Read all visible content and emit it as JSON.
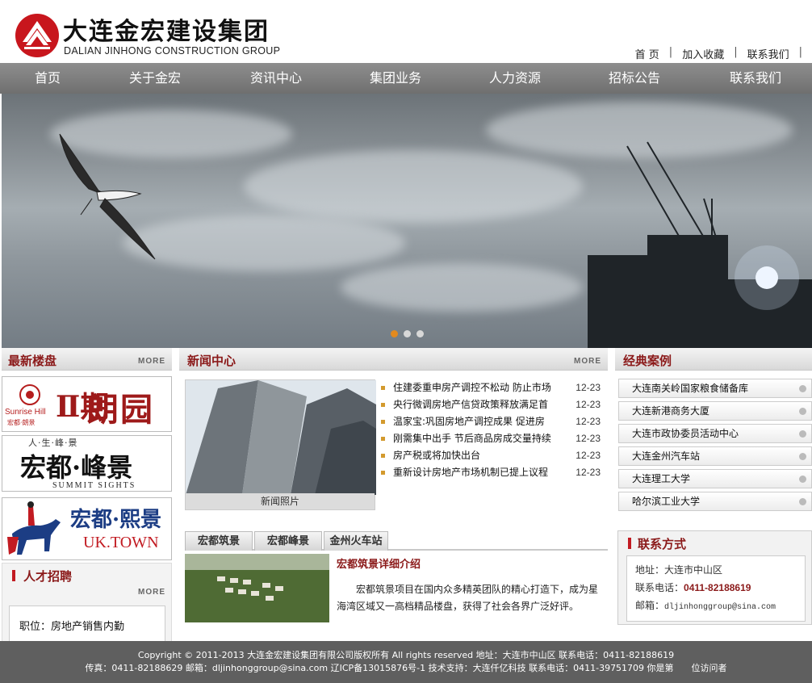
{
  "header": {
    "logo_cn": "大连金宏建设集团",
    "logo_en": "DALIAN JINHONG CONSTRUCTION GROUP",
    "links": [
      "首 页",
      "加入收藏",
      "联系我们"
    ]
  },
  "nav": {
    "items": [
      "首页",
      "关于金宏",
      "资讯中心",
      "集团业务",
      "人力资源",
      "招标公告",
      "联系我们"
    ]
  },
  "banner": {
    "slides": 3,
    "active_slide": 1
  },
  "left": {
    "latest_title": "最新楼盘",
    "more": "MORE",
    "promos": [
      {
        "en": "Sunrise Hill",
        "cn_small": "宏都·朗景",
        "phase": "Ⅱ期",
        "name": "朗园"
      },
      {
        "top": "人·生·峰·景",
        "name": "宏都·峰景",
        "en": "SUMMIT SIGHTS"
      },
      {
        "name": "宏都·熙景",
        "en": "UK.TOWN"
      }
    ],
    "jobs_title": "人才招聘",
    "jobs_more": "MORE",
    "job": "职位：房地产销售内勤"
  },
  "news": {
    "title": "新闻中心",
    "more": "MORE",
    "photo_caption": "新闻照片",
    "items": [
      {
        "title": "住建委重申房产调控不松动 防止市场",
        "date": "12-23"
      },
      {
        "title": "央行微调房地产信贷政策释放满足首",
        "date": "12-23"
      },
      {
        "title": "温家宝:巩固房地产调控成果 促进房",
        "date": "12-23"
      },
      {
        "title": "刚需集中出手 节后商品房成交量持续",
        "date": "12-23"
      },
      {
        "title": "房产税或将加快出台",
        "date": "12-23"
      },
      {
        "title": "重新设计房地产市场机制已提上议程",
        "date": "12-23"
      }
    ]
  },
  "tabs": {
    "labels": [
      "宏都筑景",
      "宏都峰景",
      "金州火车站"
    ],
    "content_title": "宏都筑景详细介绍",
    "content_text": "宏都筑景项目在国内众多精英团队的精心打造下，成为星海湾区域又一高档精品楼盘，获得了社会各界广泛好评。"
  },
  "cases": {
    "title": "经典案例",
    "items": [
      "大连南关岭国家粮食储备库",
      "大连新港商务大厦",
      "大连市政协委员活动中心",
      "大连金州汽车站",
      "大连理工大学",
      "哈尔滨工业大学"
    ]
  },
  "contact": {
    "title": "联系方式",
    "address": "地址：大连市中山区",
    "phone_label": "联系电话：",
    "phone": "0411-82188619",
    "mail_label": "邮箱：",
    "mail": "dljinhonggroup@sina.com"
  },
  "footer": {
    "line1": "Copyright © 2011-2013 大连金宏建设集团有限公司版权所有 All rights reserved 地址：大连市中山区 联系电话：0411-82188619",
    "line2": "传真：0411-82188629 邮箱：dljinhonggroup@sina.com 辽ICP备13015876号-1 技术支持：大连仟亿科技 联系电话：0411-39751709 你是第　　位访问者"
  },
  "colors": {
    "accent": "#8b1a1a",
    "nav": "#7d7d7d",
    "footer": "#5f5f5f",
    "dot_active": "#e38a1e"
  }
}
